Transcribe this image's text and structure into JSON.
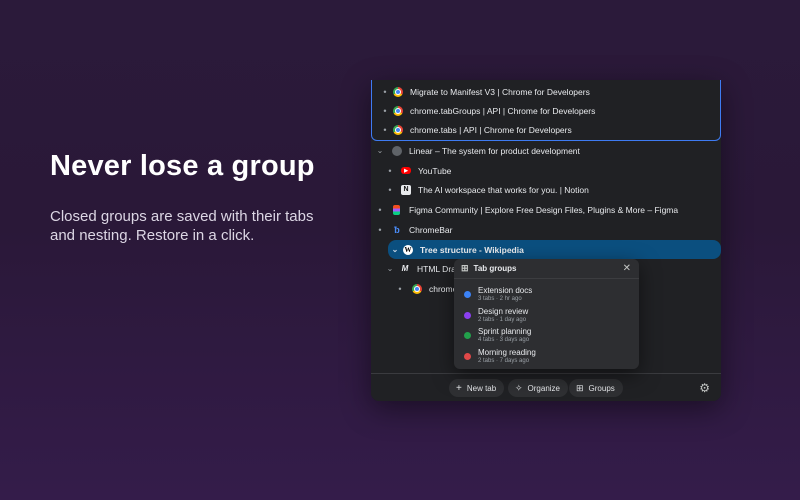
{
  "hero": {
    "title": "Never lose a group",
    "subtitle": "Closed groups are saved with their tabs and nesting. Restore in a click."
  },
  "tree": {
    "rows": [
      {
        "title": "Migrate to Manifest V3  |  Chrome for Developers",
        "icon": "chrome-icon"
      },
      {
        "title": "chrome.tabGroups  |  API  |  Chrome for Developers",
        "icon": "chrome-icon"
      },
      {
        "title": "chrome.tabs  |  API  |  Chrome for Developers",
        "icon": "chrome-icon"
      },
      {
        "title": "Linear – The system for product development",
        "icon": "globe-icon"
      },
      {
        "title": "YouTube",
        "icon": "youtube-icon"
      },
      {
        "title": "The AI workspace that works for you. | Notion",
        "icon": "notion-icon"
      },
      {
        "title": "Figma Community | Explore Free Design Files, Plugins & More – Figma",
        "icon": "figma-icon"
      },
      {
        "title": "ChromeBar",
        "icon": "chromebar-icon"
      },
      {
        "title": "Tree structure - Wikipedia",
        "icon": "wikipedia-icon"
      },
      {
        "title": "HTML Drag",
        "icon": "mdn-icon"
      },
      {
        "title": "chrome",
        "icon": "chrome-icon"
      }
    ]
  },
  "popup": {
    "title": "Tab groups",
    "groups": [
      {
        "name": "Extension docs",
        "meta": "3 tabs · 2 hr ago",
        "color": "#3b82f6"
      },
      {
        "name": "Design review",
        "meta": "2 tabs · 1 day ago",
        "color": "#8b3ff0"
      },
      {
        "name": "Sprint planning",
        "meta": "4 tabs · 3 days ago",
        "color": "#22a04b"
      },
      {
        "name": "Morning reading",
        "meta": "2 tabs · 7 days ago",
        "color": "#e04848"
      }
    ]
  },
  "toolbar": {
    "new_tab": "New tab",
    "organize": "Organize",
    "groups": "Groups"
  },
  "colors": {
    "selected_row": "#0b4f7f",
    "group_border": "#3e7bf2"
  }
}
